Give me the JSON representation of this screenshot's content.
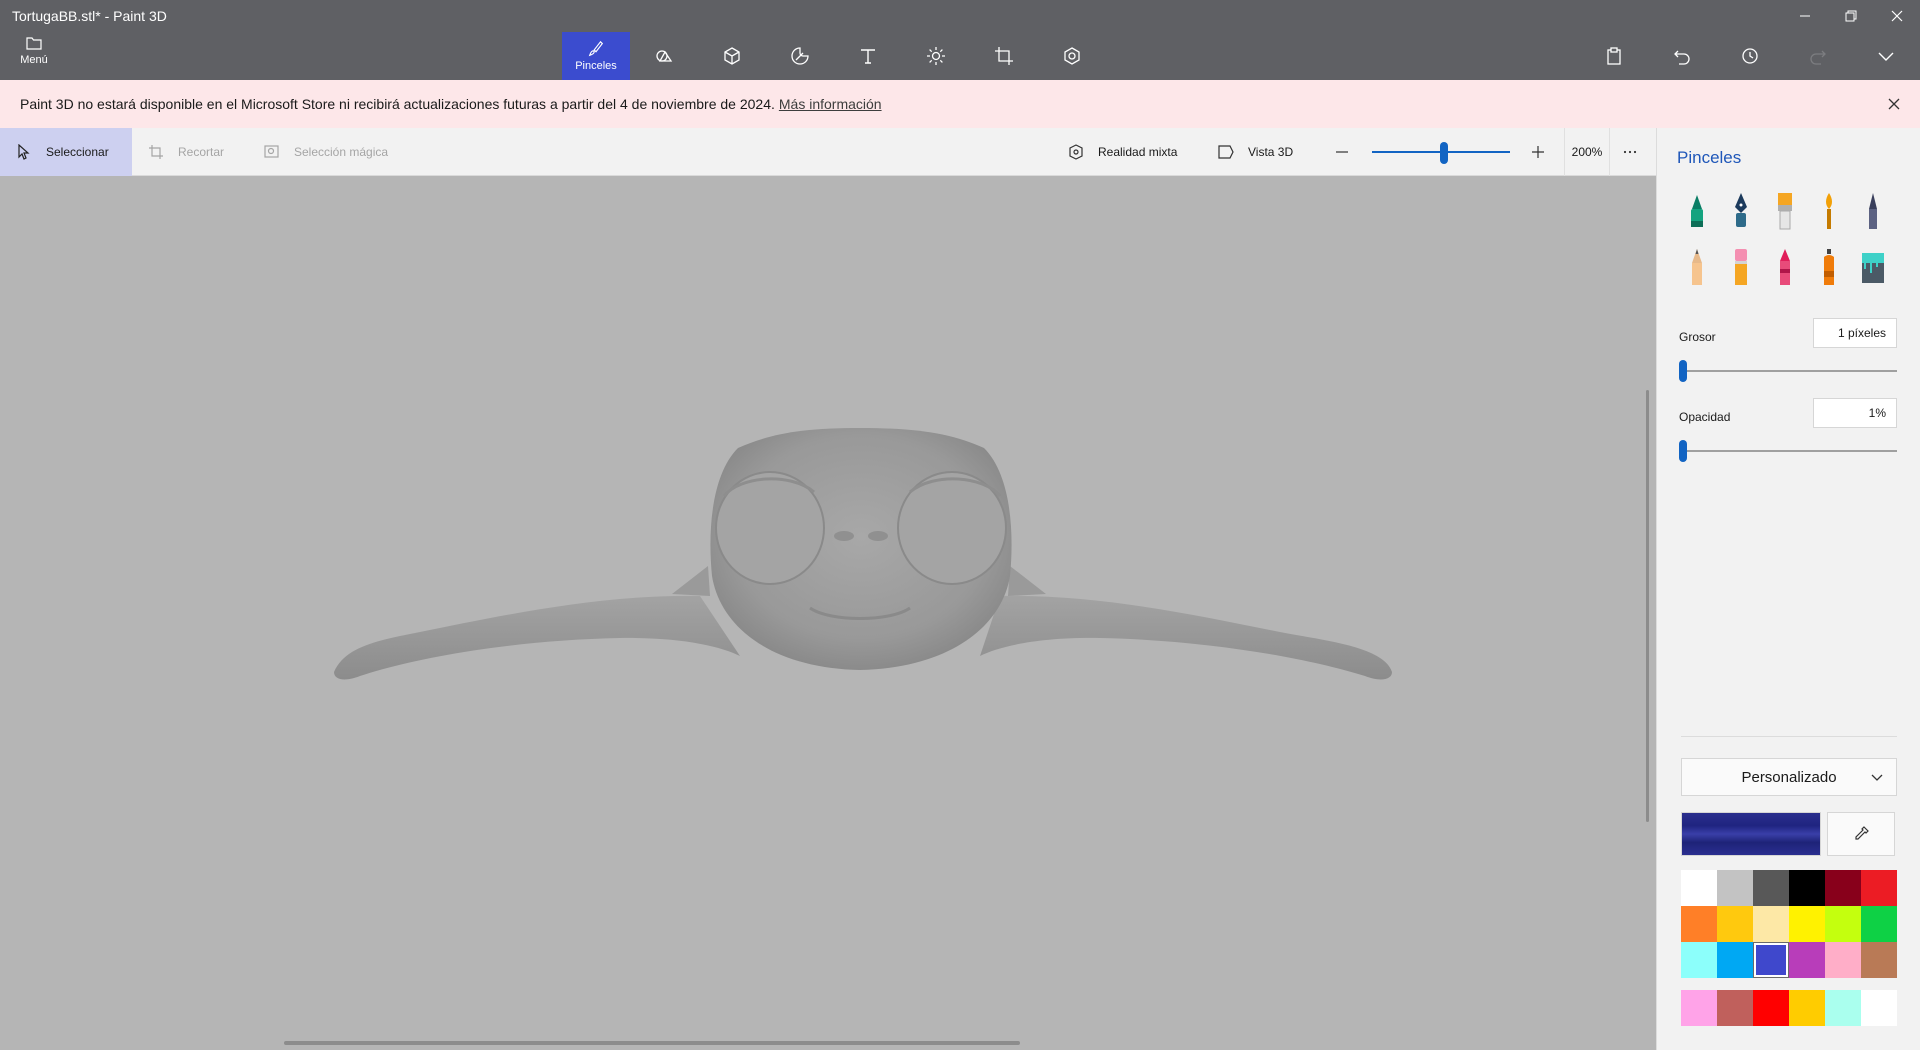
{
  "window": {
    "title": "TortugaBB.stl* - Paint 3D",
    "minimize_icon": "minimize-icon",
    "restore_icon": "restore-icon",
    "close_icon": "close-icon"
  },
  "menu": {
    "label": "Menú",
    "icon": "folder-icon"
  },
  "tools": [
    {
      "label": "Pinceles",
      "icon": "brush-icon",
      "active": true
    },
    {
      "label": "",
      "icon": "2d-shapes-icon"
    },
    {
      "label": "",
      "icon": "3d-shapes-icon"
    },
    {
      "label": "",
      "icon": "stickers-icon"
    },
    {
      "label": "",
      "icon": "text-icon"
    },
    {
      "label": "",
      "icon": "effects-icon"
    },
    {
      "label": "",
      "icon": "canvas-icon"
    },
    {
      "label": "",
      "icon": "3d-library-icon"
    }
  ],
  "banner": {
    "message": "Paint 3D no estará disponible en el Microsoft Store ni recibirá actualizaciones futuras a partir del 4 de noviembre de 2024.",
    "link": "Más información"
  },
  "options": {
    "select": "Seleccionar",
    "crop": "Recortar",
    "magic_select": "Selección mágica",
    "mixed_reality": "Realidad mixta",
    "view3d": "Vista 3D",
    "zoom": "200%"
  },
  "panel": {
    "title": "Pinceles",
    "thickness_label": "Grosor",
    "thickness_value": "1 píxeles",
    "opacity_label": "Opacidad",
    "opacity_value": "1%",
    "color_mode": "Personalizado",
    "current_color": "#23288a"
  },
  "brushes": [
    "marker",
    "calligraphy-pen",
    "oil-brush",
    "watercolor",
    "pixel-pen",
    "pencil",
    "eraser",
    "crayon",
    "spray-can",
    "fill"
  ],
  "palette": [
    "#ffffff",
    "#c3c3c3",
    "#585858",
    "#000000",
    "#88001b",
    "#ec1c24",
    "#ff7f27",
    "#ffc90e",
    "#fde8a6",
    "#fff200",
    "#c4ff0e",
    "#0ed145",
    "#8cfffb",
    "#00a8f3",
    "#3f48cc",
    "#b83dba",
    "#ffaec8",
    "#b97a56"
  ],
  "custom_palette": [
    "#ffa3e8",
    "#c0605c",
    "#ff0000",
    "#ffcc00",
    "#aaffee",
    "#ffffff"
  ]
}
